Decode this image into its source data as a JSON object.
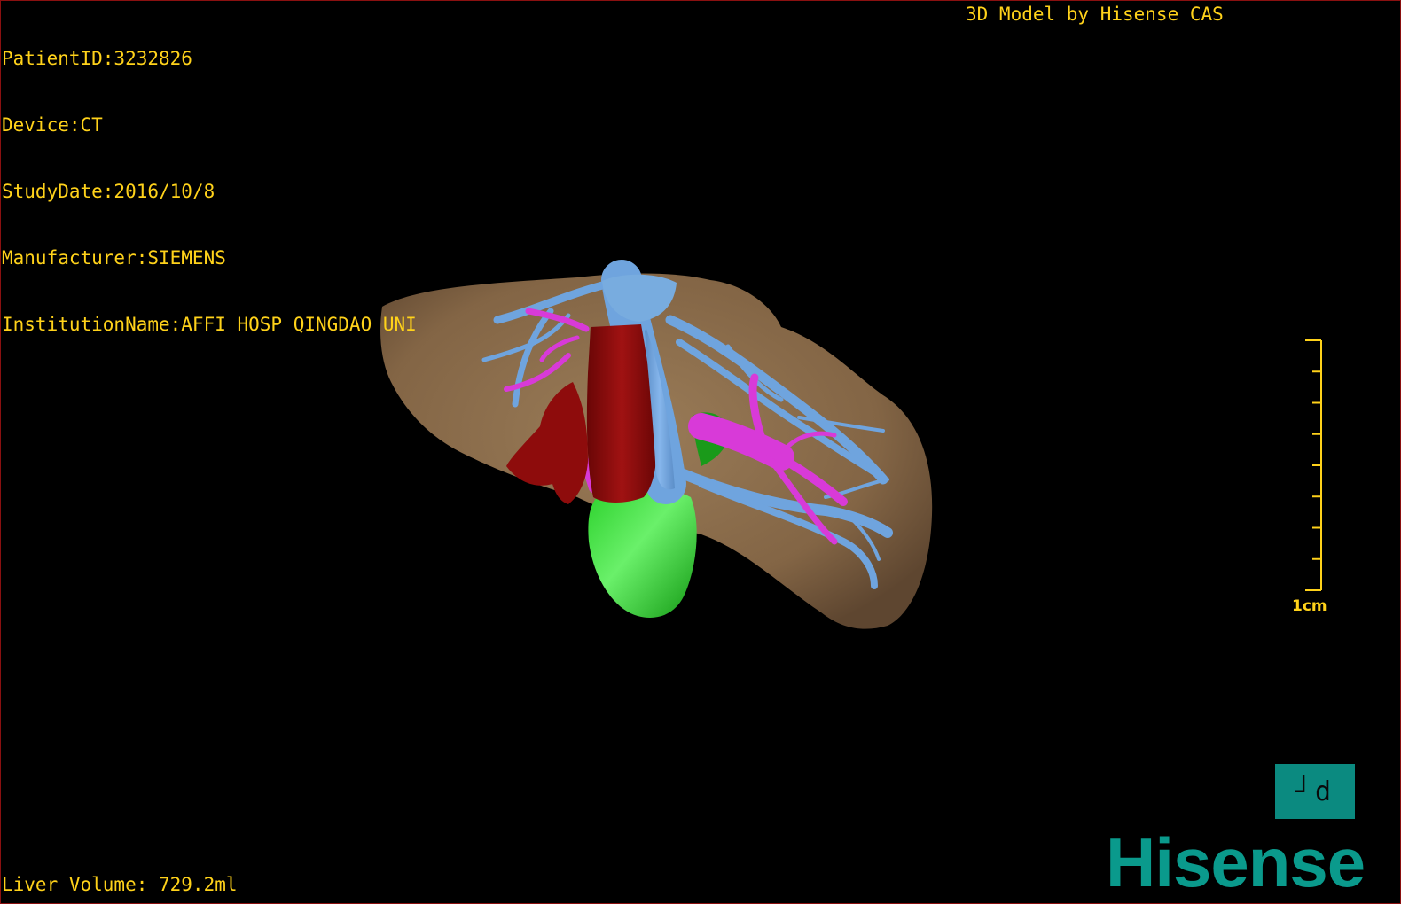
{
  "patient_info": {
    "patient_id": "PatientID:3232826",
    "device": "Device:CT",
    "study_date": "StudyDate:2016/10/8",
    "manufacturer": "Manufacturer:SIEMENS",
    "institution": "InstitutionName:AFFI HOSP QINGDAO UNI"
  },
  "model_credit": "3D Model by Hisense CAS",
  "liver_volume": "Liver Volume: 729.2ml",
  "scale": {
    "label": "1cm",
    "ticks": 9
  },
  "orientation_cube": {
    "label": "┘d"
  },
  "brand": "Hisense",
  "colors": {
    "overlay_text": "#ffd21a",
    "liver": "#8c7050",
    "hepatic_vein": "#6a9fd8",
    "portal_vein": "#d23ad2",
    "ivc": "#8a0a0a",
    "gallbladder": "#1fbf1f",
    "brand": "#0a9a8c",
    "viewport_border": "#8a1010"
  },
  "anatomy_icons": [
    "liver-icon",
    "hepatic-vein-icon",
    "portal-vein-icon",
    "inferior-vena-cava-icon",
    "gallbladder-icon"
  ]
}
